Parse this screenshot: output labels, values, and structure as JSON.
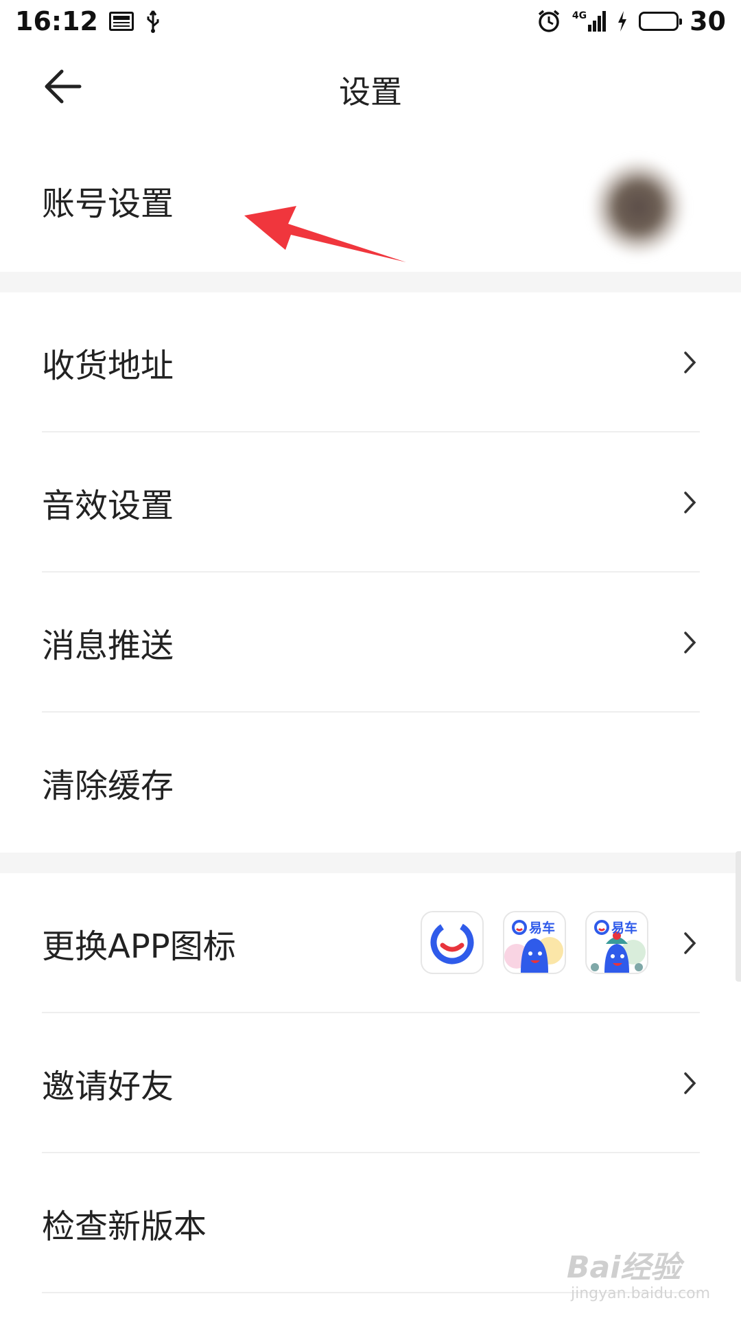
{
  "status_bar": {
    "time": "16:12",
    "network": "4G",
    "battery": "30",
    "battery_level": 0.3,
    "battery_color": "#31c53a"
  },
  "header": {
    "title": "设置"
  },
  "rows": {
    "account": "账号设置",
    "address": "收货地址",
    "sound": "音效设置",
    "push": "消息推送",
    "cache": "清除缓存",
    "app_icon": "更换APP图标",
    "invite": "邀请好友",
    "version": "检查新版本"
  },
  "app_icons": [
    {
      "name": "default-app-icon",
      "color": "#2f5bea"
    },
    {
      "name": "yiche-mascot-icon",
      "text": "易车",
      "color": "#2f5bea"
    },
    {
      "name": "yiche-opera-mascot-icon",
      "text": "易车",
      "color": "#2f5bea"
    }
  ],
  "annotation": {
    "arrow_color": "#f0363d"
  },
  "watermark": {
    "brand": "Bai经验",
    "url": "jingyan.baidu.com"
  }
}
